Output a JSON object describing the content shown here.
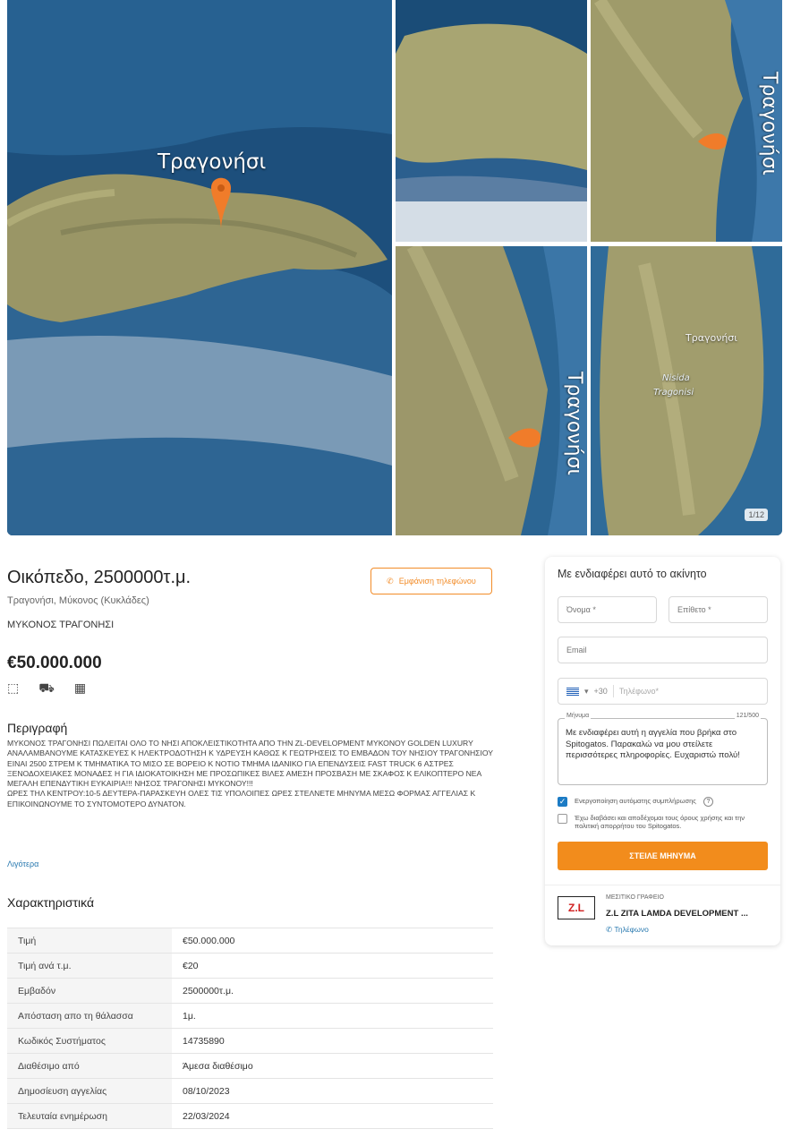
{
  "gallery": {
    "main_label": "Τραγονήσι",
    "tile_labels": [
      "Τραγονήσι",
      "Τραγονήσι",
      "Τραγονήσι",
      "Nisida",
      "Tragonisi"
    ],
    "photo_count": "1/12"
  },
  "listing": {
    "title": "Οικόπεδο, 2500000τ.μ.",
    "location": "Τραγονήσι, Μύκονος (Κυκλάδες)",
    "subtitle": "ΜΥΚΟΝΟΣ ΤΡΑΓΟΝΗΣΙ",
    "price": "€50.000.000",
    "phone_button": "Εμφάνιση τηλεφώνου",
    "feature_icons": [
      "area-icon",
      "tractor-icon",
      "building-plot-icon"
    ]
  },
  "description": {
    "heading": "Περιγραφή",
    "text": "ΜΥΚΟΝΟΣ ΤΡΑΓΟΝΗΣΙ ΠΩΛΕΙΤΑΙ ΟΛΟ ΤΟ ΝΗΣΙ ΑΠΟΚΛΕΙΣΤΙΚΟΤΗΤΑ ΑΠΟ ΤΗΝ ZL-DEVELOPMENT ΜΥΚΟΝΟΥ GOLDEN LUXURY ΑΝΑΛΑΜΒΑΝΟΥΜΕ ΚΑΤΑΣΚΕΥΕΣ Κ ΗΛΕΚΤΡΟΔΟΤΗΣΗ Κ ΥΔΡΕΥΣΗ ΚΑΘΩΣ Κ ΓΕΩΤΡΗΣΕΙΣ ΤΟ ΕΜΒΑΔΟΝ ΤΟΥ ΝΗΣΙΟΥ ΤΡΑΓΟΝΗΣΙΟΥ ΕΙΝΑΙ 2500 ΣΤΡΕΜ Κ ΤΜΗΜΑΤΙΚΑ ΤΟ ΜΙΣΟ ΣΕ ΒΟΡΕΙΟ Κ ΝΟΤΙΟ ΤΜΗΜΑ ΙΔΑΝΙΚΟ ΓΙΑ ΕΠΕΝΔΥΣΕΙΣ FAST TRUCK 6 ΑΣΤΡΕΣ ΞΕΝΟΔΟΧΕΙΑΚΕΣ ΜΟΝΑΔΕΣ Η ΓΙΑ ΙΔΙΟΚΑΤΟΙΚΗΣΗ ΜΕ ΠΡΟΣΩΠΙΚΕΣ ΒΙΛΕΣ ΑΜΕΣΗ ΠΡΟΣΒΑΣΗ ΜΕ ΣΚΑΦΟΣ Κ ΕΛΙΚΟΠΤΕΡΟ ΝΕΑ ΜΕΓΑΛΗ ΕΠΕΝΔΥΤΙΚΗ ΕΥΚΑΙΡΙΑ!!! ΝΗΣΟΣ ΤΡΑΓΟΝΗΣΙ ΜΥΚΟΝΟΥ!!!",
    "text2": "ΩΡΕΣ ΤΗΛ ΚΕΝΤΡΟΥ:10-5 ΔΕΥΤΕΡΑ-ΠΑΡΑΣΚΕΥΗ ΟΛΕΣ ΤΙΣ ΥΠΟΛΟΙΠΕΣ ΩΡΕΣ ΣΤΕΛΝΕΤΕ ΜΗΝΥΜΑ ΜΕΣΩ ΦΟΡΜΑΣ ΑΓΓΕΛΙΑΣ Κ ΕΠΙΚΟΙΝΩΝΟΥΜΕ ΤΟ ΣΥΝΤΟΜΟΤΕΡΟ ΔΥΝΑΤΟΝ.",
    "more_link": "Λιγότερα"
  },
  "specs": {
    "heading": "Χαρακτηριστικά",
    "rows": [
      {
        "label": "Τιμή",
        "value": "€50.000.000"
      },
      {
        "label": "Τιμή ανά τ.μ.",
        "value": "€20"
      },
      {
        "label": "Εμβαδόν",
        "value": "2500000τ.μ."
      },
      {
        "label": "Απόσταση απο τη θάλασσα",
        "value": "1μ."
      },
      {
        "label": "Κωδικός Συστήματος",
        "value": "14735890"
      },
      {
        "label": "Διαθέσιμο από",
        "value": "Άμεσα διαθέσιμο"
      },
      {
        "label": "Δημοσίευση αγγελίας",
        "value": "08/10/2023"
      },
      {
        "label": "Τελευταία ενημέρωση",
        "value": "22/03/2024"
      }
    ]
  },
  "contact": {
    "heading": "Με ενδιαφέρει αυτό το ακίνητο",
    "first_name_placeholder": "Όνομα *",
    "last_name_placeholder": "Επίθετο *",
    "email_placeholder": "Email",
    "country_code": "+30",
    "phone_placeholder": "Τηλέφωνο*",
    "message_label": "Μήνυμα",
    "message_count": "121/500",
    "message_text": "Με ενδιαφέρει αυτή η αγγελία που βρήκα στο Spitogatos. Παρακαλώ να μου στείλετε περισσότερες πληροφορίες. Ευχαριστώ πολύ!",
    "autofill_label": "Ενεργοποίηση αυτόματης συμπλήρωσης",
    "terms_label": "Έχω διαβάσει και αποδέχομαι τους όρους χρήσης και την πολιτική απορρήτου του Spitogatos.",
    "send_button": "ΣΤΕΙΛΕ ΜΗΝΥΜΑ",
    "agency_type": "ΜΕΣΙΤΙΚΟ ΓΡΑΦΕΙΟ",
    "agency_name": "Z.L ZITA LAMDA DEVELOPMENT ...",
    "agency_logo": "Z.L",
    "agency_phone": "Τηλέφωνο"
  },
  "colors": {
    "accent": "#f28c1c",
    "link": "#2a7ab0",
    "sea": "#1f5580",
    "land": "#9c9a6a"
  }
}
